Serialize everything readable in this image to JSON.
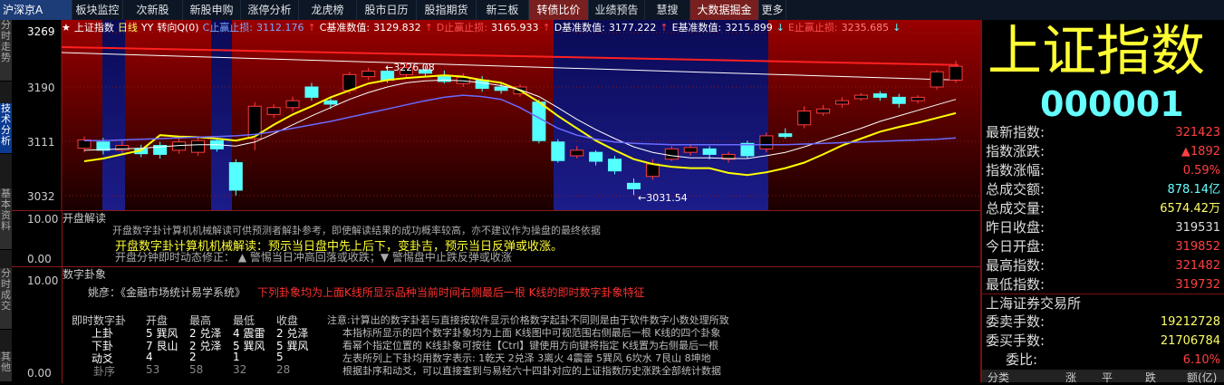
{
  "topbar": {
    "tabs": [
      "沪深京A",
      "板块监控",
      "次新股",
      "新股申购",
      "涨停分析",
      "龙虎榜",
      "股市日历",
      "股指期货",
      "新三板",
      "转债比价",
      "业绩预告",
      "慧搜",
      "大数据掘金",
      "更多"
    ]
  },
  "sidebar": {
    "items": [
      "分时走势",
      "技术分析",
      "基本资料",
      "分时成交",
      "其他"
    ]
  },
  "chart": {
    "legend": {
      "index": "上证指数",
      "period": "日线",
      "yy": "YY",
      "indicator": "转向Q(0)",
      "c_stop_label": "C止赢止损:",
      "c_stop_val": "3112.176",
      "c_base_label": "C基准数值:",
      "c_base_val": "3129.832",
      "d_stop_label": "D止赢止损:",
      "d_stop_val": "3165.933",
      "d_base_label": "D基准数值:",
      "d_base_val": "3177.222",
      "e_base_label": "E基准数值:",
      "e_base_val": "3215.899",
      "e_stop_label": "E止赢止损:",
      "e_stop_val": "3235.685"
    },
    "y_ticks": [
      "3269",
      "3190",
      "3111",
      "3032"
    ],
    "high_marker": "3226.08",
    "low_marker": "3031.54"
  },
  "panel1": {
    "title": "开盘解读",
    "axis": [
      "10.00",
      "0.00"
    ],
    "line1": "开盘数字卦计算机机械解读可供预测者解卦参考，即使解读结果的成功概率较高，亦不建议作为操盘的最终依据",
    "line2": "开盘数字卦计算机机械解读：预示当日盘中先上后下，变卦吉，预示当日反弹或收涨。",
    "line3": "开盘分钟即时动态修正：  ▲  警惕当日冲高回落或收跌；▼  警惕盘中止跌反弹或收涨"
  },
  "panel2": {
    "title": "数字卦象",
    "axis": [
      "10.00",
      "0.00"
    ],
    "subtitle_a": "姚彦：《金融市场统计易学系统》",
    "subtitle_b": "下列卦象均为上面K线所显示品种当前时间右侧最后一根 K线的即时数字卦象特征",
    "table_headers": [
      "即时数字卦",
      "开盘",
      "最高",
      "最低",
      "收盘"
    ],
    "rows": [
      {
        "name": "上卦",
        "vals": [
          "5 巽风",
          "2 兑泽",
          "4 震雷",
          "2 兑泽"
        ]
      },
      {
        "name": "下卦",
        "vals": [
          "7 艮山",
          "2 兑泽",
          "5 巽风",
          "5 巽风"
        ]
      },
      {
        "name": "动爻",
        "vals": [
          "4",
          "2",
          "1",
          "5"
        ]
      },
      {
        "name": "卦序",
        "vals": [
          "53",
          "58",
          "32",
          "28"
        ]
      }
    ],
    "note": [
      "注意:计算出的数字卦若与直接按软件显示价格数字起卦不同则是由于软件数字小数处理所致",
      "本指标所显示的四个数字卦象均为上面 K线图中可视范围右侧最后一根 K线的四个卦象",
      "看幂个指定位置的 K线卦象可按往【Ctrl】键使用方向键将指定 K线置为右侧最后一根",
      "左表所列上下卦均用数字表示: 1乾天 2兑泽 3离火 4震雷 5巽风 6坎水 7艮山 8坤地",
      "根据卦序和动爻，可以直接查到与易经六十四卦对应的上证指数历史涨跌全部统计数据"
    ]
  },
  "quote": {
    "name": "上证指数",
    "code": "000001",
    "rows": [
      {
        "k": "最新指数:",
        "v": "321423",
        "c": "#ff4040"
      },
      {
        "k": "指数涨跌:",
        "v": "▲1892",
        "c": "#ff4040"
      },
      {
        "k": "指数涨幅:",
        "v": "0.59%",
        "c": "#ff4040"
      },
      {
        "k": "总成交额:",
        "v": "878.14亿",
        "c": "#66ffff"
      },
      {
        "k": "总成交量:",
        "v": "6574.42万",
        "c": "#ffff66"
      },
      {
        "k": "昨日收盘:",
        "v": "319531",
        "c": "#dddddd"
      },
      {
        "k": "今日开盘:",
        "v": "319852",
        "c": "#ff4040"
      },
      {
        "k": "最高指数:",
        "v": "321482",
        "c": "#ff4040"
      },
      {
        "k": "最低指数:",
        "v": "319732",
        "c": "#ff4040"
      }
    ],
    "exchange": "上海证券交易所",
    "rows2": [
      {
        "k": "委卖手数:",
        "v": "19212728",
        "c": "#ffff66"
      },
      {
        "k": "委买手数:",
        "v": "21706784",
        "c": "#ffff66"
      },
      {
        "k": "委比:",
        "v": "6.10%",
        "c": "#ff4040"
      }
    ],
    "footer_tabs": [
      "分类",
      "涨",
      "平",
      "跌",
      "额(亿)"
    ]
  },
  "colors": {
    "up": "#ff3c3c",
    "down": "#54ffff",
    "ma_yellow": "#ffff00",
    "ma_white": "#ffffff",
    "ma_blue": "#6a6aff",
    "red_zone": "#8b0000",
    "blue_zone": "#14146e"
  }
}
